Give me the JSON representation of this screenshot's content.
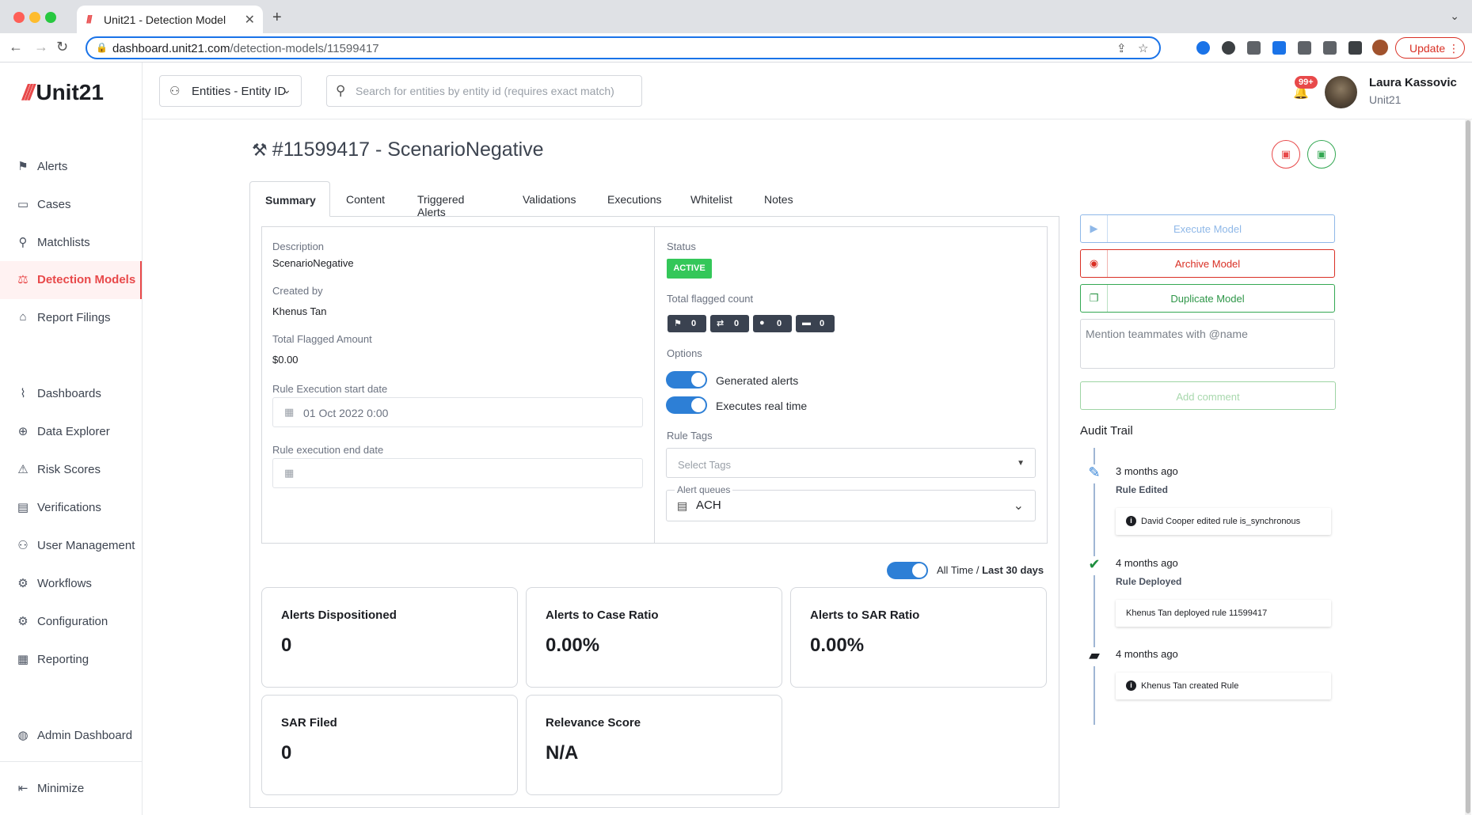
{
  "browser": {
    "tab_title": "Unit21 - Detection Model",
    "url_domain": "dashboard.unit21.com",
    "url_path": "/detection-models/11599417",
    "update_label": "Update"
  },
  "sidebar": {
    "logo": "Unit21",
    "items": [
      {
        "label": "Alerts",
        "icon": "flag-icon"
      },
      {
        "label": "Cases",
        "icon": "briefcase-icon"
      },
      {
        "label": "Matchlists",
        "icon": "user-search-icon"
      },
      {
        "label": "Detection Models",
        "icon": "scale-icon",
        "active": true
      },
      {
        "label": "Report Filings",
        "icon": "bank-icon"
      },
      {
        "label": "Dashboards",
        "icon": "chart-icon"
      },
      {
        "label": "Data Explorer",
        "icon": "zoom-chart-icon"
      },
      {
        "label": "Risk Scores",
        "icon": "warning-icon"
      },
      {
        "label": "Verifications",
        "icon": "id-card-icon"
      },
      {
        "label": "User Management",
        "icon": "users-icon"
      },
      {
        "label": "Workflows",
        "icon": "workflow-icon"
      },
      {
        "label": "Configuration",
        "icon": "gear-icon"
      },
      {
        "label": "Reporting",
        "icon": "report-icon"
      },
      {
        "label": "Admin Dashboard",
        "icon": "globe-icon"
      }
    ],
    "minimize_label": "Minimize"
  },
  "header": {
    "entity_select": "Entities - Entity ID",
    "search_placeholder": "Search for entities by entity id (requires exact match)",
    "notifications_badge": "99+",
    "user_name": "Laura Kassovic",
    "user_org": "Unit21"
  },
  "page": {
    "title": "#11599417 - ScenarioNegative",
    "tabs": [
      "Summary",
      "Content",
      "Triggered Alerts",
      "Validations",
      "Executions",
      "Whitelist",
      "Notes"
    ],
    "active_tab": "Summary"
  },
  "summary": {
    "description_label": "Description",
    "description": "ScenarioNegative",
    "created_by_label": "Created by",
    "created_by": "Khenus Tan",
    "total_flagged_amount_label": "Total Flagged Amount",
    "total_flagged_amount": "$0.00",
    "start_date_label": "Rule Execution start date",
    "start_date": "01 Oct 2022 0:00",
    "end_date_label": "Rule execution end date",
    "end_date": "",
    "status_label": "Status",
    "status": "ACTIVE",
    "status_color": "#34c759",
    "flagged_count_label": "Total flagged count",
    "flagged_counts": [
      {
        "icon": "flag-icon",
        "value": "0"
      },
      {
        "icon": "transfer-icon",
        "value": "0"
      },
      {
        "icon": "user-icon",
        "value": "0"
      },
      {
        "icon": "card-icon",
        "value": "0"
      }
    ],
    "options_label": "Options",
    "option_generated_alerts": "Generated alerts",
    "option_real_time": "Executes real time",
    "rule_tags_label": "Rule Tags",
    "rule_tags_placeholder": "Select Tags",
    "alert_queues_label": "Alert queues",
    "alert_queue_value": "ACH"
  },
  "metrics": {
    "time_toggle_all": "All Time /",
    "time_toggle_last": "Last 30 days",
    "cards": [
      {
        "title": "Alerts Dispositioned",
        "value": "0"
      },
      {
        "title": "Alerts to Case Ratio",
        "value": "0.00%"
      },
      {
        "title": "Alerts to SAR Ratio",
        "value": "0.00%"
      },
      {
        "title": "SAR Filed",
        "value": "0"
      },
      {
        "title": "Relevance Score",
        "value": "N/A"
      }
    ]
  },
  "actions": {
    "execute_model": "Execute Model",
    "archive_model": "Archive Model",
    "duplicate_model": "Duplicate Model",
    "comment_placeholder": "Mention teammates with @name",
    "add_comment": "Add comment"
  },
  "audit_trail": {
    "title": "Audit Trail",
    "entries": [
      {
        "time": "3 months ago",
        "event": "Rule Edited",
        "detail": "David Cooper edited rule is_synchronous",
        "icon": "pencil-icon"
      },
      {
        "time": "4 months ago",
        "event": "Rule Deployed",
        "detail": "Khenus Tan deployed rule 11599417",
        "icon": "check-icon"
      },
      {
        "time": "4 months ago",
        "event": "",
        "detail": "Khenus Tan created Rule",
        "icon": "briefcase-icon"
      }
    ]
  },
  "colors": {
    "accent": "#e8494a",
    "toggle": "#2d7fd6",
    "archive": "#d93025",
    "duplicate": "#34a853",
    "execute": "#8fb8e8"
  }
}
